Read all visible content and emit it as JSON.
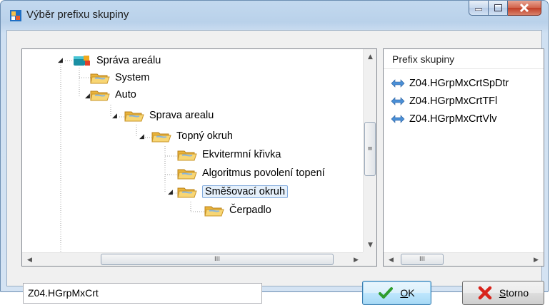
{
  "window": {
    "title": "Výběr prefixu skupiny",
    "icons": [
      "app-icon",
      "minimize-icon",
      "maximize-icon",
      "close-icon"
    ]
  },
  "tree": {
    "nodes": [
      {
        "label": "Správa areálu",
        "level": 0,
        "icon": "building-icon",
        "expanded": true
      },
      {
        "label": "System",
        "level": 1,
        "icon": "folder-icon",
        "expanded": false
      },
      {
        "label": "Auto",
        "level": 1,
        "icon": "folder-icon",
        "expanded": true
      },
      {
        "label": "Sprava arealu",
        "level": 2,
        "icon": "folder-icon",
        "expanded": true
      },
      {
        "label": "Topný okruh",
        "level": 3,
        "icon": "folder-icon",
        "expanded": true
      },
      {
        "label": "Ekvitermní křivka",
        "level": 4,
        "icon": "folder-icon",
        "expanded": false
      },
      {
        "label": "Algoritmus povolení topení",
        "level": 4,
        "icon": "folder-icon",
        "expanded": false
      },
      {
        "label": "Směšovací okruh",
        "level": 4,
        "icon": "folder-icon",
        "expanded": true,
        "selected": true
      },
      {
        "label": "Čerpadlo",
        "level": 5,
        "icon": "folder-icon",
        "expanded": false
      }
    ],
    "hscroll_thumb_label": "III",
    "vscroll_thumb_label": "≡"
  },
  "prefix_list": {
    "header": "Prefix skupiny",
    "items": [
      "Z04.HGrpMxCrtSpDtr",
      "Z04.HGrpMxCrtTFl",
      "Z04.HGrpMxCrtVlv"
    ],
    "hscroll_thumb_label": "III"
  },
  "prefix_input": {
    "value": "Z04.HGrpMxCrt"
  },
  "buttons": {
    "ok": {
      "mnemonic": "O",
      "rest": "K",
      "icon": "checkmark-icon"
    },
    "cancel": {
      "mnemonic": "S",
      "rest": "torno",
      "icon": "red-x-icon"
    }
  },
  "colors": {
    "selection_bg": "#e5f0fb",
    "selection_border": "#84acdd",
    "title_bg": "#b9d1ea",
    "close_red": "#c13e26"
  }
}
